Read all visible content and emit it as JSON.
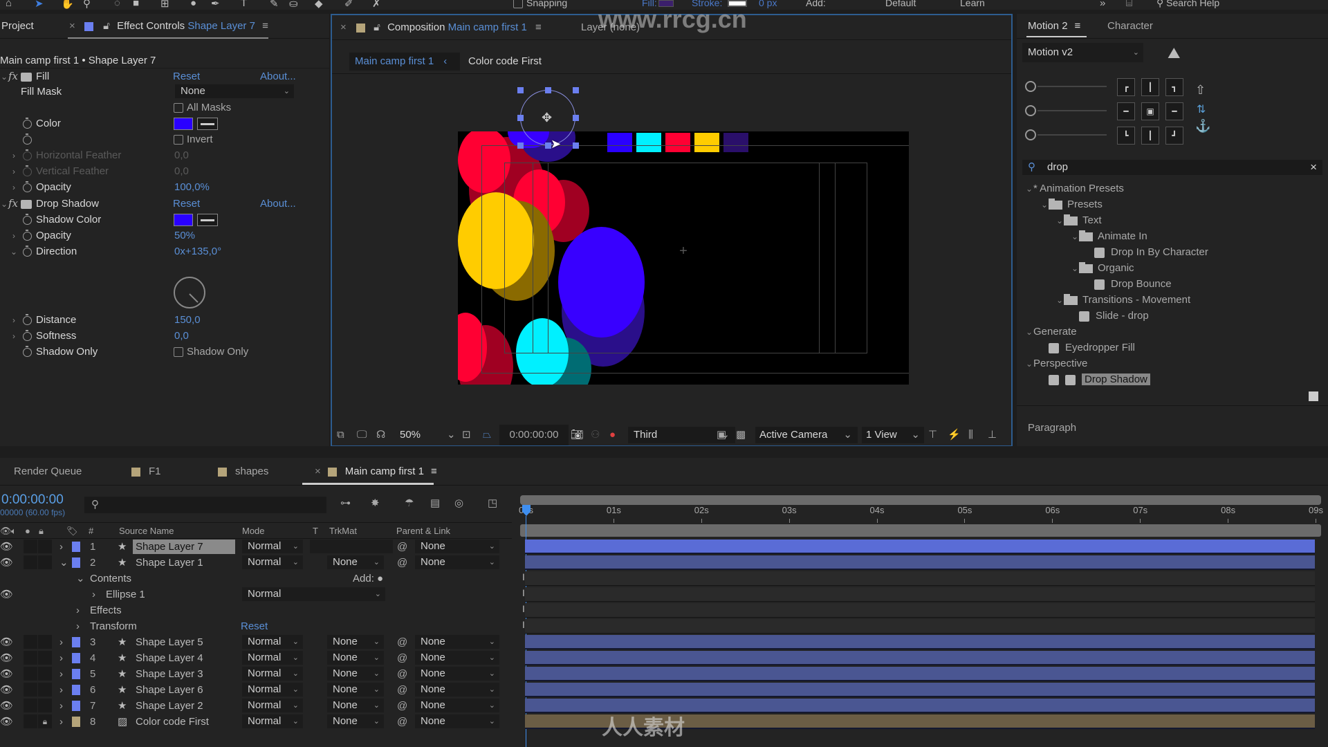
{
  "toolbar": {
    "snapping_label": "Snapping",
    "fill_label": "Fill:",
    "stroke_label": "Stroke:",
    "stroke_width": "0 px",
    "add_label": "Add:",
    "workspace_default": "Default",
    "workspace_learn": "Learn",
    "search_help": "Search Help",
    "fill_color": "#3b1f6b"
  },
  "project_tab": {
    "label": "Project"
  },
  "effect_controls": {
    "tab_prefix": "Effect Controls",
    "tab_layer": "Shape Layer 7",
    "breadcrumb": "Main camp first 1 • Shape Layer 7",
    "fill": {
      "name": "Fill",
      "reset": "Reset",
      "about": "About...",
      "fill_mask_label": "Fill Mask",
      "fill_mask_value": "None",
      "all_masks_label": "All Masks",
      "color_label": "Color",
      "color_value": "#2a00ff",
      "invert_label": "Invert",
      "h_feather_label": "Horizontal Feather",
      "h_feather_value": "0,0",
      "v_feather_label": "Vertical Feather",
      "v_feather_value": "0,0",
      "opacity_label": "Opacity",
      "opacity_value": "100,0%"
    },
    "drop_shadow": {
      "name": "Drop Shadow",
      "reset": "Reset",
      "about": "About...",
      "shadow_color_label": "Shadow Color",
      "shadow_color_value": "#2a00ff",
      "opacity_label": "Opacity",
      "opacity_value": "50%",
      "direction_label": "Direction",
      "direction_value": "0x+135,0°",
      "distance_label": "Distance",
      "distance_value": "150,0",
      "softness_label": "Softness",
      "softness_value": "0,0",
      "shadow_only_label": "Shadow Only",
      "shadow_only_checkbox": "Shadow Only"
    }
  },
  "composition": {
    "tab_prefix": "Composition",
    "tab_comp": "Main camp first 1",
    "layer_tab": "Layer (none)",
    "watermark": "www.rrcg.cn",
    "breadcrumb_active": "Main camp first 1",
    "breadcrumb_next": "Color code First",
    "footer": {
      "zoom": "50%",
      "timecode": "0:00:00:00",
      "resolution": "Third",
      "camera": "Active Camera",
      "view": "1 View"
    },
    "swatches": [
      "#2a00ff",
      "#00f0ff",
      "#ff0033",
      "#ffcc00",
      "#2a0f6a"
    ]
  },
  "right_panel": {
    "tab_motion": "Motion 2",
    "tab_character": "Character",
    "motion_version": "Motion v2",
    "search_value": "drop",
    "tree": [
      {
        "label": "* Animation Presets",
        "type": "root",
        "level": 0
      },
      {
        "label": "Presets",
        "type": "folder",
        "level": 1
      },
      {
        "label": "Text",
        "type": "folder",
        "level": 2
      },
      {
        "label": "Animate In",
        "type": "folder",
        "level": 3
      },
      {
        "label": "Drop In By Character",
        "type": "preset",
        "level": 4
      },
      {
        "label": "Organic",
        "type": "folder",
        "level": 3
      },
      {
        "label": "Drop Bounce",
        "type": "preset",
        "level": 4
      },
      {
        "label": "Transitions - Movement",
        "type": "folder",
        "level": 2
      },
      {
        "label": "Slide - drop",
        "type": "preset",
        "level": 3
      },
      {
        "label": "Generate",
        "type": "category",
        "level": 0
      },
      {
        "label": "Eyedropper Fill",
        "type": "effect",
        "level": 1
      },
      {
        "label": "Perspective",
        "type": "category",
        "level": 0
      },
      {
        "label": "Drop Shadow",
        "type": "effect",
        "level": 1,
        "selected": true
      }
    ],
    "paragraph_label": "Paragraph"
  },
  "timeline": {
    "tabs": [
      {
        "label": "Render Queue"
      },
      {
        "label": "F1",
        "color": "#b5a47a"
      },
      {
        "label": "shapes",
        "color": "#b5a47a"
      },
      {
        "label": "Main camp first 1",
        "color": "#b5a47a",
        "active": true
      }
    ],
    "timecode": "0:00:00:00",
    "frame_info": "00000 (60.00 fps)",
    "columns": {
      "num": "#",
      "source_name": "Source Name",
      "mode": "Mode",
      "t": "T",
      "trkmat": "TrkMat",
      "parent": "Parent & Link"
    },
    "ruler": [
      "00s",
      "01s",
      "02s",
      "03s",
      "04s",
      "05s",
      "06s",
      "07s",
      "08s",
      "09s"
    ],
    "layers": [
      {
        "num": "1",
        "name": "Shape Layer 7",
        "mode": "Normal",
        "trkmat": "",
        "parent": "None",
        "selected": true
      },
      {
        "num": "2",
        "name": "Shape Layer 1",
        "mode": "Normal",
        "trkmat": "None",
        "parent": "None",
        "expanded": true
      },
      {
        "num": "3",
        "name": "Shape Layer 5",
        "mode": "Normal",
        "trkmat": "None",
        "parent": "None"
      },
      {
        "num": "4",
        "name": "Shape Layer 4",
        "mode": "Normal",
        "trkmat": "None",
        "parent": "None"
      },
      {
        "num": "5",
        "name": "Shape Layer 3",
        "mode": "Normal",
        "trkmat": "None",
        "parent": "None"
      },
      {
        "num": "6",
        "name": "Shape Layer 6",
        "mode": "Normal",
        "trkmat": "None",
        "parent": "None"
      },
      {
        "num": "7",
        "name": "Shape Layer 2",
        "mode": "Normal",
        "trkmat": "None",
        "parent": "None"
      },
      {
        "num": "8",
        "name": "Color code First",
        "mode": "Normal",
        "trkmat": "None",
        "parent": "None",
        "locked": true
      }
    ],
    "sub_rows": {
      "contents": "Contents",
      "add_label": "Add:",
      "ellipse": "Ellipse 1",
      "ellipse_mode": "Normal",
      "effects": "Effects",
      "transform": "Transform",
      "transform_reset": "Reset"
    },
    "bottom_watermark": "人人素材"
  }
}
